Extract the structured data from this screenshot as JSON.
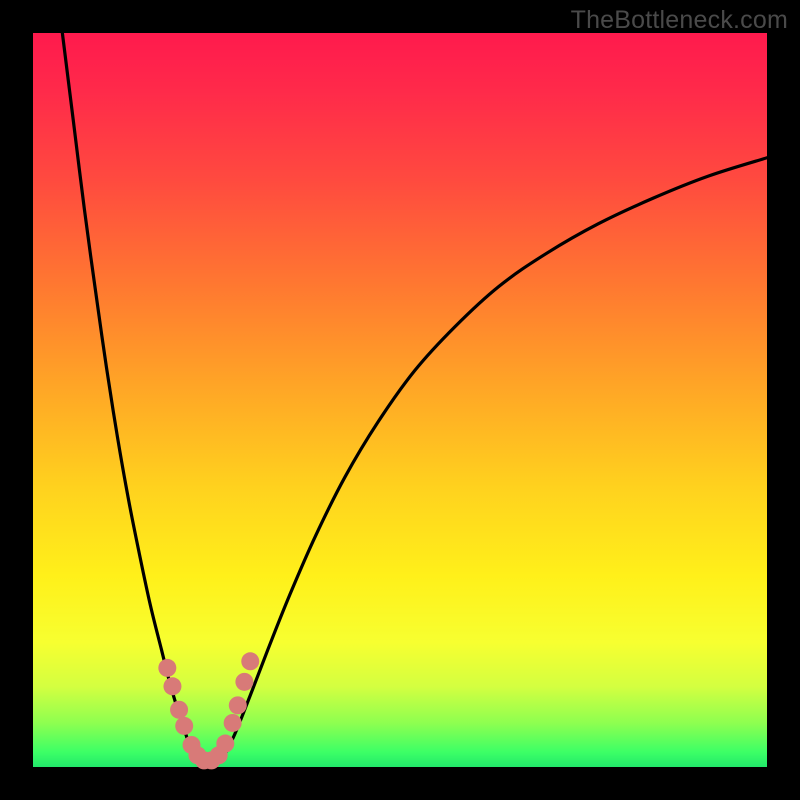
{
  "watermark": "TheBottleneck.com",
  "colors": {
    "frame": "#000000",
    "gradient_top": "#ff1a4d",
    "gradient_mid_upper": "#ff7a30",
    "gradient_mid": "#ffd21e",
    "gradient_lower": "#f7ff30",
    "gradient_bottom": "#22e86a",
    "curve": "#000000",
    "dot": "#d87a78"
  },
  "chart_data": {
    "type": "line",
    "title": "",
    "xlabel": "",
    "ylabel": "",
    "xlim": [
      0,
      100
    ],
    "ylim": [
      0,
      100
    ],
    "note": "Axes are unlabeled; x is normalized horizontal position 0–100, y is normalized vertical value 0–100 (0 = bottom/green, 100 = top/red). Values estimated from pixel positions.",
    "series": [
      {
        "name": "curve-left",
        "x": [
          4.0,
          5.5,
          7.0,
          8.5,
          10.0,
          11.5,
          13.0,
          14.5,
          16.0,
          17.5,
          18.5,
          19.5,
          20.5,
          21.3,
          22.0
        ],
        "values": [
          100.0,
          88.0,
          76.0,
          65.0,
          54.5,
          45.0,
          36.5,
          29.0,
          22.0,
          16.0,
          12.0,
          8.5,
          5.5,
          3.0,
          1.5
        ]
      },
      {
        "name": "curve-bottom",
        "x": [
          22.0,
          22.8,
          23.6,
          24.4,
          25.2,
          26.0
        ],
        "values": [
          1.5,
          0.8,
          0.5,
          0.5,
          0.8,
          1.5
        ]
      },
      {
        "name": "curve-right",
        "x": [
          26.0,
          27.5,
          29.5,
          32.0,
          35.0,
          38.5,
          42.5,
          47.0,
          52.0,
          57.5,
          63.5,
          70.0,
          77.0,
          84.5,
          92.0,
          100.0
        ],
        "values": [
          1.5,
          4.5,
          9.5,
          16.0,
          23.5,
          31.5,
          39.5,
          47.0,
          54.0,
          60.0,
          65.5,
          70.0,
          74.0,
          77.5,
          80.5,
          83.0
        ]
      }
    ],
    "dots": {
      "name": "highlight-dots",
      "x": [
        18.3,
        19.0,
        19.9,
        20.6,
        21.6,
        22.4,
        23.3,
        24.3,
        25.3,
        26.2,
        27.2,
        27.9,
        28.8,
        29.6
      ],
      "values": [
        13.5,
        11.0,
        7.8,
        5.6,
        3.0,
        1.6,
        0.9,
        0.9,
        1.6,
        3.2,
        6.0,
        8.4,
        11.6,
        14.4
      ]
    }
  }
}
